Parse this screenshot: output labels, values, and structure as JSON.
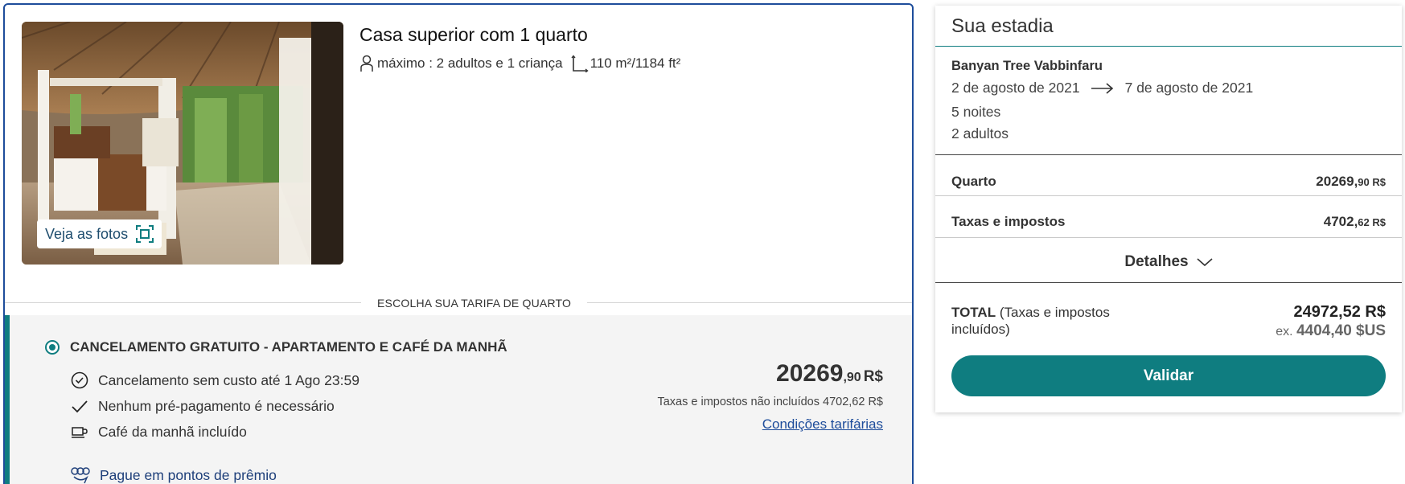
{
  "room": {
    "photo_button_label": "Veja as fotos",
    "title": "Casa superior com 1 quarto",
    "occupancy": "máximo : 2 adultos e 1 criança",
    "area": "110 m²/1184 ft²"
  },
  "tariff": {
    "caption": "ESCOLHA SUA TARIFA DE QUARTO",
    "rate_name": "CANCELAMENTO GRATUITO - APARTAMENTO E CAFÉ DA MANHÃ",
    "conditions": [
      {
        "icon": "clock-icon",
        "text": "Cancelamento sem custo até 1 Ago 23:59"
      },
      {
        "icon": "checkmark-icon",
        "text": "Nenhum pré-pagamento é necessário"
      },
      {
        "icon": "coffee-cup-icon",
        "text": "Café da manhã incluído"
      }
    ],
    "points_link": "Pague em pontos de prêmio",
    "price_main": "20269",
    "price_cents": ",90",
    "price_currency": "R$",
    "tax_note": "Taxas e impostos não incluídos 4702,62 R$",
    "conditions_link": "Condições tarifárias"
  },
  "stay": {
    "title": "Sua estadia",
    "hotel": "Banyan Tree Vabbinfaru",
    "check_in": "2 de agosto de 2021",
    "check_out": "7 de agosto de 2021",
    "nights": "5 noites",
    "guests": "2 adultos",
    "room_label": "Quarto",
    "room_amount_main": "20269,",
    "room_amount_small": "90 R$",
    "taxes_label": "Taxas e impostos",
    "taxes_amount_main": "4702,",
    "taxes_amount_small": "62 R$",
    "details_label": "Detalhes",
    "total_label": "TOTAL",
    "total_note": "(Taxas e impostos incluídos)",
    "total_amount": "24972,52 R$",
    "total_usd_prefix": "ex.",
    "total_usd": "4404,40 $US",
    "validate_label": "Validar"
  },
  "colors": {
    "accent_teal": "#0f7d80",
    "card_border_blue": "#1e4d9b",
    "link_blue": "#1e4d9b"
  }
}
